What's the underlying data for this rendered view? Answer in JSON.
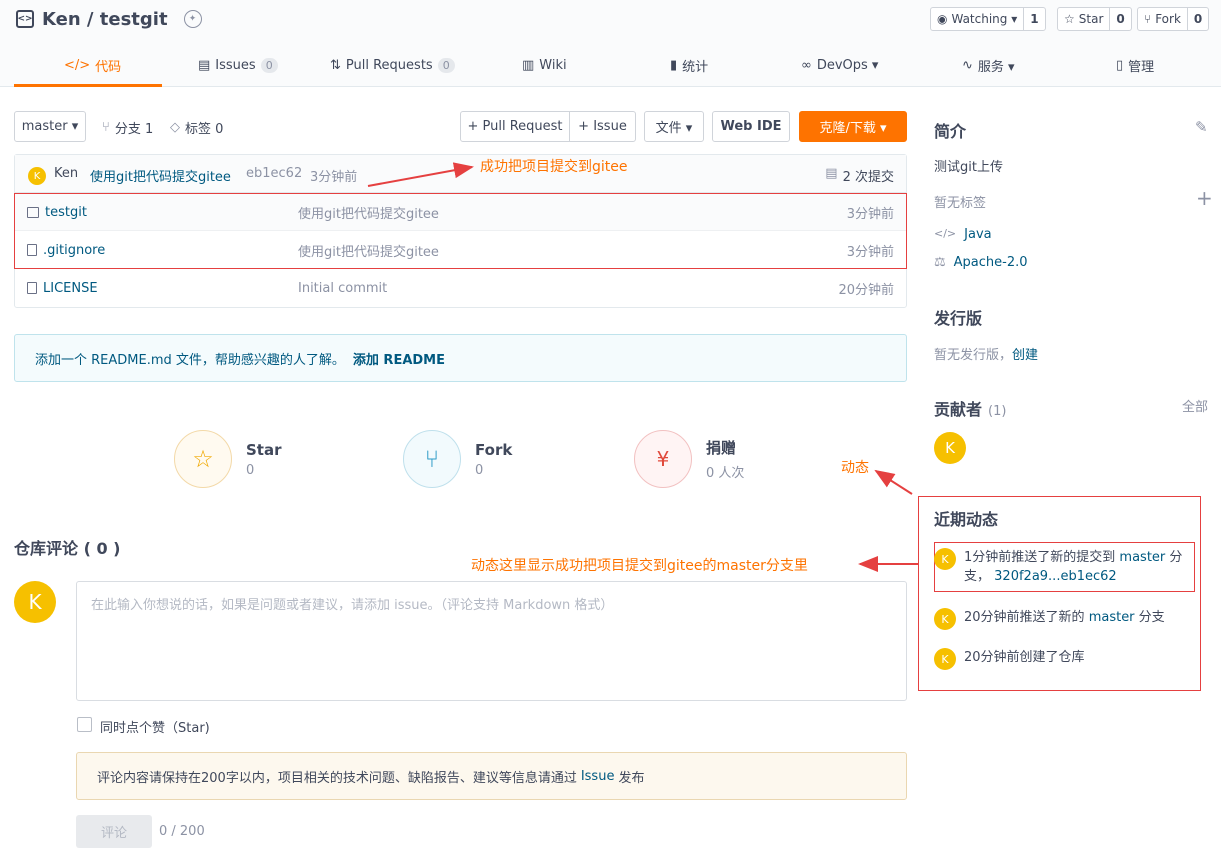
{
  "repo": {
    "title": "Ken / testgit"
  },
  "header_buttons": {
    "watch": {
      "label": "Watching ▾",
      "count": "1"
    },
    "star": {
      "label": "Star",
      "count": "0"
    },
    "fork": {
      "label": "Fork",
      "count": "0"
    }
  },
  "tabs": [
    {
      "label": "代码",
      "count": null
    },
    {
      "label": "Issues",
      "count": "0"
    },
    {
      "label": "Pull Requests",
      "count": "0"
    },
    {
      "label": "Wiki",
      "count": null
    },
    {
      "label": "统计",
      "count": null
    },
    {
      "label": "DevOps ▾",
      "count": null
    },
    {
      "label": "服务 ▾",
      "count": null
    },
    {
      "label": "管理",
      "count": null
    }
  ],
  "toolbar": {
    "branch": "master ▾",
    "branches": "分支 1",
    "tags": "标签 0",
    "pull_request": "+ Pull Request",
    "issue": "+ Issue",
    "file": "文件 ▾",
    "web_ide": "Web IDE",
    "clone": "克隆/下载 ▾"
  },
  "commit": {
    "avatar": "K",
    "author": "Ken",
    "message": "使用git把代码提交gitee",
    "hash": "eb1ec62",
    "time": "3分钟前",
    "count": "2 次提交"
  },
  "files": [
    {
      "name": "testgit",
      "message": "使用git把代码提交gitee",
      "time": "3分钟前"
    },
    {
      "name": ".gitignore",
      "message": "使用git把代码提交gitee",
      "time": "3分钟前"
    },
    {
      "name": "LICENSE",
      "message": "Initial commit",
      "time": "20分钟前"
    }
  ],
  "readme": {
    "text": "添加一个 README.md 文件，帮助感兴趣的人了解。",
    "link": "添加 README"
  },
  "stats": [
    {
      "title": "Star",
      "value": "0"
    },
    {
      "title": "Fork",
      "value": "0"
    },
    {
      "title": "捐赠",
      "value": "0 人次"
    }
  ],
  "comments": {
    "title": "仓库评论 ( 0 )",
    "avatar": "K",
    "placeholder": "在此输入你想说的话，如果是问题或者建议，请添加 issue。（评论支持 Markdown 格式）",
    "star_check": "同时点个赞（Star)",
    "notice_pre": "评论内容请保持在200字以内，项目相关的技术问题、缺陷报告、建议等信息请通过",
    "notice_link": "Issue",
    "notice_post": "发布",
    "submit": "评论",
    "counter": "0 / 200"
  },
  "sidebar": {
    "intro_title": "简介",
    "description": "测试git上传",
    "no_tags": "暂无标签",
    "language": "Java",
    "license": "Apache-2.0",
    "release_title": "发行版",
    "no_release": "暂无发行版，",
    "create": "创建",
    "contributors_title": "贡献者",
    "contributors_count": "(1)",
    "all": "全部",
    "contributor_avatar": "K",
    "activity_title": "近期动态",
    "activities": [
      {
        "avatar": "K",
        "pre": "1分钟前推送了新的提交到",
        "branch": "master",
        "post": "分支，",
        "ref": "320f2a9...eb1ec62"
      },
      {
        "avatar": "K",
        "pre": "20分钟前推送了新的",
        "branch": "master",
        "post": "分支"
      },
      {
        "avatar": "K",
        "pre": "20分钟前创建了仓库"
      }
    ]
  },
  "annotations": {
    "commit_note": "成功把项目提交到gitee",
    "activity_label": "动态",
    "activity_note": "动态这里显示成功把项目提交到gitee的master分支里"
  },
  "colors": {
    "accent": "#fe7300",
    "link": "#005980",
    "annotation": "#e54040",
    "avatar": "#f6c000"
  }
}
